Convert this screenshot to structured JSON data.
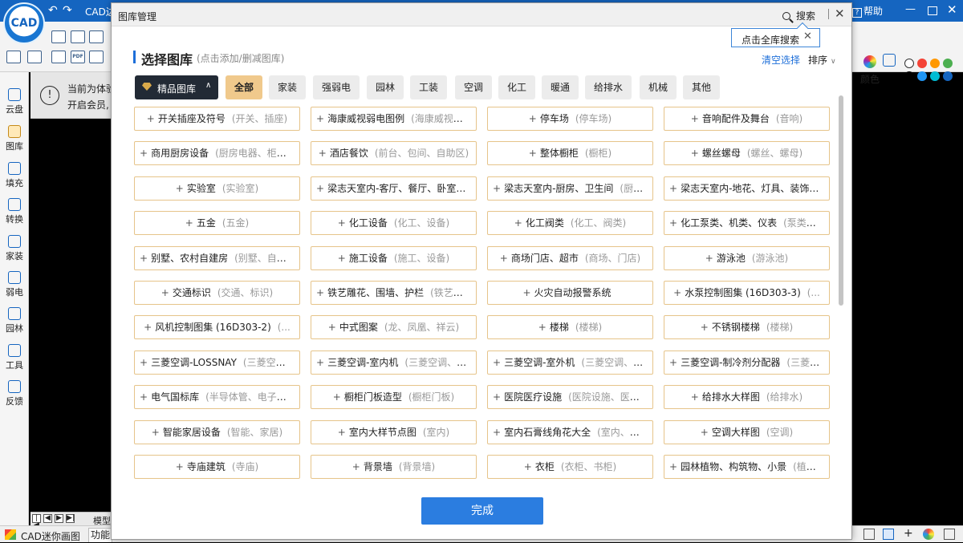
{
  "app": {
    "title": "CAD迷你画图",
    "title_partial": "CAD边",
    "help_label": "帮助",
    "color_label": "颜色",
    "info_banner": {
      "line1": "当前为体验",
      "line2": "开启会员,"
    },
    "sidebar": [
      {
        "label": "云盘",
        "icon": "cloud-icon"
      },
      {
        "label": "图库",
        "icon": "image-library-icon"
      },
      {
        "label": "填充",
        "icon": "hatch-fill-icon"
      },
      {
        "label": "转换",
        "icon": "convert-icon"
      },
      {
        "label": "家装",
        "icon": "home-icon"
      },
      {
        "label": "弱电",
        "icon": "lightning-icon"
      },
      {
        "label": "园林",
        "icon": "tree-icon"
      },
      {
        "label": "工具",
        "icon": "tools-icon"
      },
      {
        "label": "反馈",
        "icon": "mail-icon"
      }
    ],
    "model_tab": "模型",
    "status_app": "CAD迷你画图",
    "status_func": "功能",
    "swatches": [
      "#ffffff",
      "#f44336",
      "#ff9800",
      "#4caf50",
      "#000000",
      "#2196f3",
      "#00bcd4",
      "#1565c0"
    ]
  },
  "dialog": {
    "title": "图库管理",
    "search_label": "搜索",
    "tooltip": "点击全库搜索",
    "section_title": "选择图库",
    "section_hint": "(点击添加/删减图库)",
    "clear_label": "清空选择",
    "sort_label": "排序",
    "premium_label": "精品图库",
    "categories": [
      {
        "label": "全部",
        "active": true
      },
      {
        "label": "家装",
        "active": false
      },
      {
        "label": "强弱电",
        "active": false
      },
      {
        "label": "园林",
        "active": false
      },
      {
        "label": "工装",
        "active": false
      },
      {
        "label": "空调",
        "active": false
      },
      {
        "label": "化工",
        "active": false
      },
      {
        "label": "暖通",
        "active": false
      },
      {
        "label": "给排水",
        "active": false
      },
      {
        "label": "机械",
        "active": false
      },
      {
        "label": "其他",
        "active": false
      }
    ],
    "libraries": [
      {
        "name": "开关插座及符号",
        "tags": "(开关、插座)"
      },
      {
        "name": "海康威视弱电图例",
        "tags": "(海康威视、弱..."
      },
      {
        "name": "停车场",
        "tags": "(停车场)"
      },
      {
        "name": "音响配件及舞台",
        "tags": "(音响)"
      },
      {
        "name": "商用厨房设备",
        "tags": "(厨房电器、柜台、..."
      },
      {
        "name": "酒店餐饮",
        "tags": "(前台、包间、自助区)"
      },
      {
        "name": "整体橱柜",
        "tags": "(橱柜)"
      },
      {
        "name": "螺丝螺母",
        "tags": "(螺丝、螺母)"
      },
      {
        "name": "实验室",
        "tags": "(实验室)"
      },
      {
        "name": "梁志天室内-客厅、餐厅、卧室",
        "tags": "(..."
      },
      {
        "name": "梁志天室内-厨房、卫生间",
        "tags": "(厨房..."
      },
      {
        "name": "梁志天室内-地花、灯具、装饰",
        "tags": "(..."
      },
      {
        "name": "五金",
        "tags": "(五金)"
      },
      {
        "name": "化工设备",
        "tags": "(化工、设备)"
      },
      {
        "name": "化工阀类",
        "tags": "(化工、阀类)"
      },
      {
        "name": "化工泵类、机类、仪表",
        "tags": "(泵类、机..."
      },
      {
        "name": "别墅、农村自建房",
        "tags": "(别墅、自建房)"
      },
      {
        "name": "施工设备",
        "tags": "(施工、设备)"
      },
      {
        "name": "商场门店、超市",
        "tags": "(商场、门店)"
      },
      {
        "name": "游泳池",
        "tags": "(游泳池)"
      },
      {
        "name": "交通标识",
        "tags": "(交通、标识)"
      },
      {
        "name": "铁艺雕花、围墙、护栏",
        "tags": "(铁艺、雕..."
      },
      {
        "name": "火灾自动报警系统",
        "tags": ""
      },
      {
        "name": "水泵控制图集 (16D303-3)",
        "tags": "(..."
      },
      {
        "name": "风机控制图集 (16D303-2)",
        "tags": "(..."
      },
      {
        "name": "中式图案",
        "tags": "(龙、凤凰、祥云)"
      },
      {
        "name": "楼梯",
        "tags": "(楼梯)"
      },
      {
        "name": "不锈钢楼梯",
        "tags": "(楼梯)"
      },
      {
        "name": "三菱空调-LOSSNAY",
        "tags": "(三菱空调..."
      },
      {
        "name": "三菱空调-室内机",
        "tags": "(三菱空调、室..."
      },
      {
        "name": "三菱空调-室外机",
        "tags": "(三菱空调、室..."
      },
      {
        "name": "三菱空调-制冷剂分配器",
        "tags": "(三菱空..."
      },
      {
        "name": "电气国标库",
        "tags": "(半导体管、电子管、..."
      },
      {
        "name": "橱柜门板造型",
        "tags": "(橱柜门板)"
      },
      {
        "name": "医院医疗设施",
        "tags": "(医院设施、医疗设..."
      },
      {
        "name": "给排水大样图",
        "tags": "(给排水)"
      },
      {
        "name": "智能家居设备",
        "tags": "(智能、家居)"
      },
      {
        "name": "室内大样节点图",
        "tags": "(室内)"
      },
      {
        "name": "室内石膏线角花大全",
        "tags": "(室内、石膏..."
      },
      {
        "name": "空调大样图",
        "tags": "(空调)"
      },
      {
        "name": "寺庙建筑",
        "tags": "(寺庙)"
      },
      {
        "name": "背景墙",
        "tags": "(背景墙)"
      },
      {
        "name": "衣柜",
        "tags": "(衣柜、书柜)"
      },
      {
        "name": "园林植物、构筑物、小景",
        "tags": "(植物、..."
      }
    ],
    "done_label": "完成"
  }
}
